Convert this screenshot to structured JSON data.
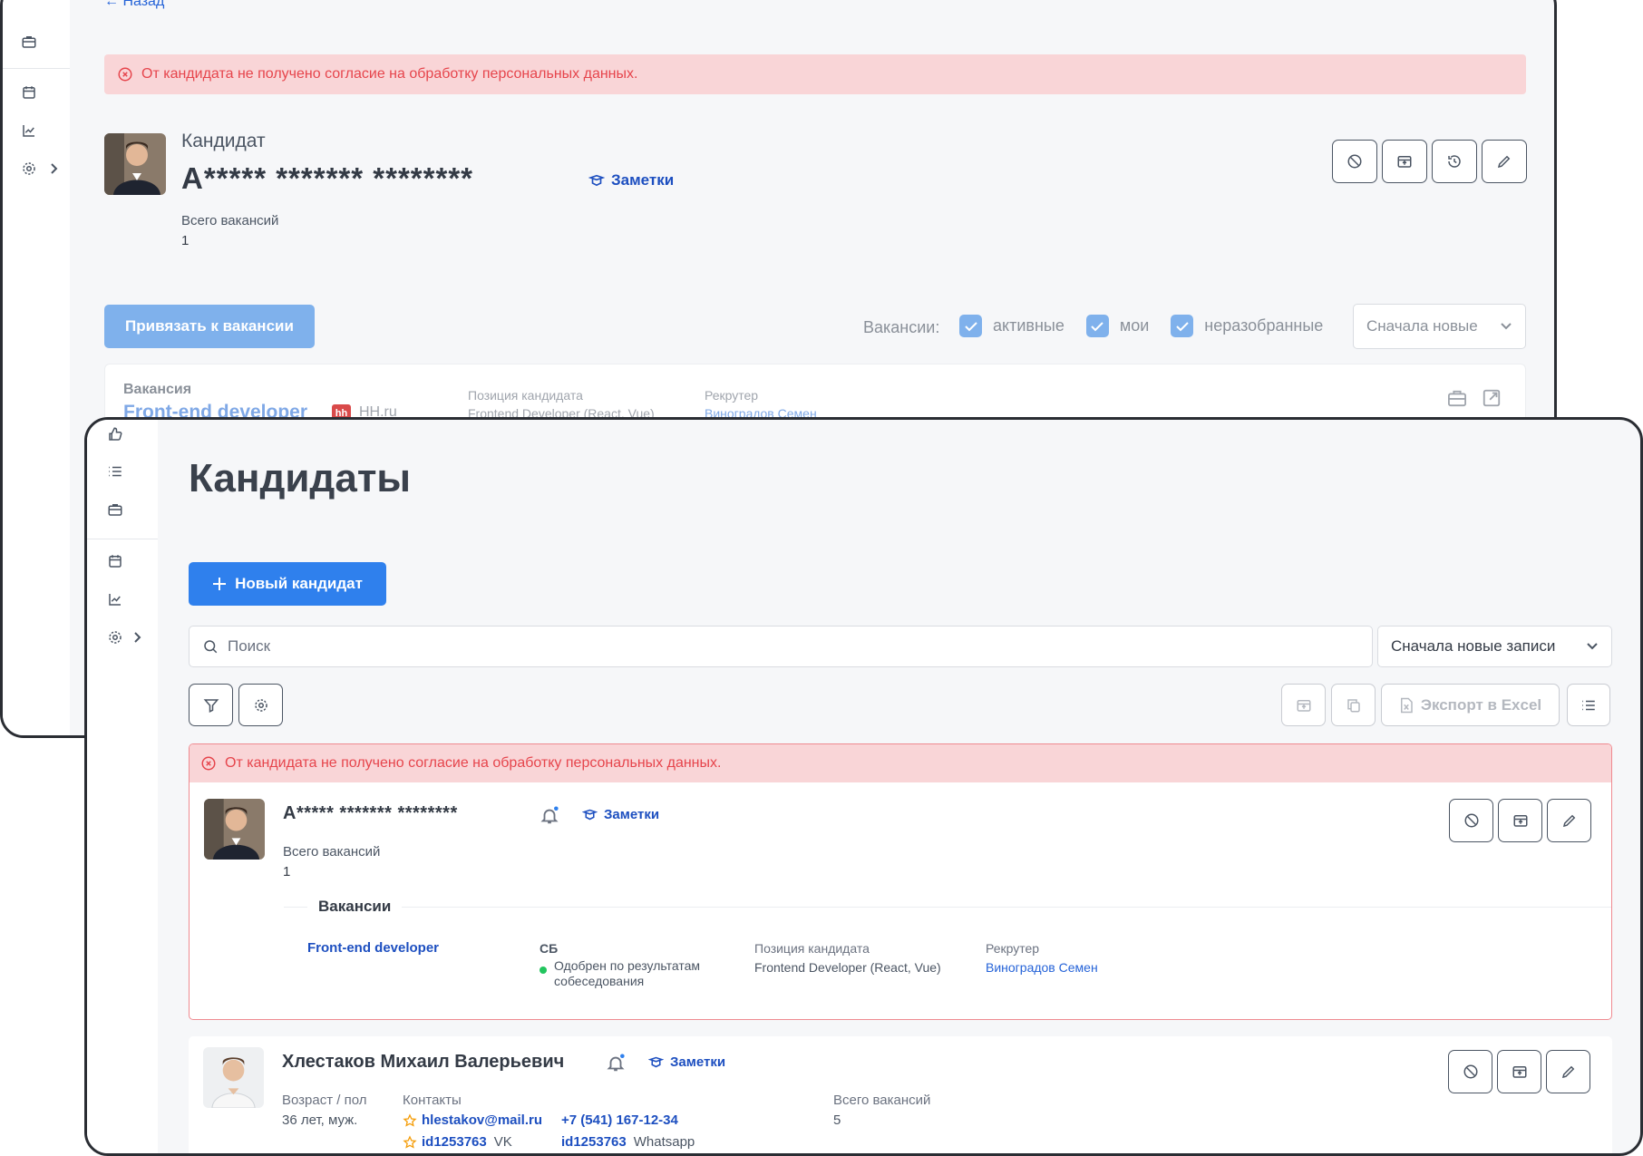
{
  "back": {
    "top_link": "← Назад",
    "alert": "От кандидата не получено согласие на обработку персональных данных.",
    "candidate_label": "Кандидат",
    "candidate_name": "А***** ******* ********",
    "notes_label": "Заметки",
    "total_vacancies_label": "Всего вакансий",
    "total_vacancies_value": "1",
    "attach_button": "Привязать к вакансии",
    "vacancies_filter_label": "Вакансии:",
    "filter_active": "активные",
    "filter_mine": "мои",
    "filter_unsorted": "неразобранные",
    "sort_value": "Сначала новые",
    "vacancy_header": "Вакансия",
    "vacancy_title": "Front-end developer",
    "vacancy_source_badge": "hh",
    "vacancy_source": "HH.ru",
    "position_label": "Позиция кандидата",
    "position_value": "Frontend Developer (React, Vue)",
    "recruiter_label": "Рекрутер",
    "recruiter_value": "Виноградов Семен"
  },
  "front": {
    "page_title": "Кандидаты",
    "new_candidate_button": "Новый кандидат",
    "search_placeholder": "Поиск",
    "sort_value": "Сначала новые записи",
    "export_button": "Экспорт в Excel",
    "alert": "От кандидата не получено согласие на обработку персональных данных.",
    "candidates": [
      {
        "name": "А***** ******* ********",
        "notes": "Заметки",
        "total_vacancies_label": "Всего вакансий",
        "total_vacancies_value": "1",
        "vacancies_section": "Вакансии",
        "vacancy_title": "Front-end developer",
        "stage": "СБ",
        "stage_status": "Одобрен по результатам собеседования",
        "position_label": "Позиция кандидата",
        "position_value": "Frontend Developer (React, Vue)",
        "recruiter_label": "Рекрутер",
        "recruiter_value": "Виноградов Семен"
      },
      {
        "name": "Хлестаков Михаил Валерьевич",
        "notes": "Заметки",
        "age_sex_label": "Возраст / пол",
        "age_sex_value": "36 лет, муж.",
        "contacts_label": "Контакты",
        "email": "hlestakov@mail.ru",
        "phone": "+7 (541) 167-12-34",
        "vk_id": "id1253763",
        "vk_label": "VK",
        "whatsapp_id": "id1253763",
        "whatsapp_label": "Whatsapp",
        "total_vacancies_label": "Всего вакансий",
        "total_vacancies_value": "5"
      }
    ]
  },
  "colors": {
    "primary": "#2f80ed",
    "primary_disabled": "#7fb1ec",
    "link": "#2563d8",
    "alert_bg": "#f9d5d7",
    "alert_text": "#e6454c",
    "status_green": "#22c55e"
  }
}
